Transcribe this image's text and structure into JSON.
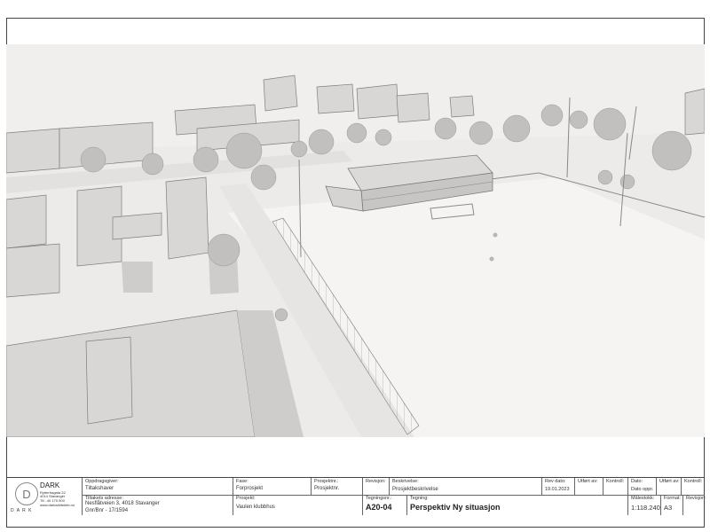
{
  "firm": {
    "name": "DARK",
    "address_line1": "Rytterfragata 22",
    "address_line2": "4014 Stavanger",
    "phone": "Tlf.: 40 170 500",
    "web": "www.darkarkitekter.no",
    "wordmark": "D A R K",
    "logo_letter": "D"
  },
  "title_block": {
    "oppdragsgiver_label": "Oppdragsgiver:",
    "oppdragsgiver": "Tiltakshaver",
    "tiltak_label": "Tiltakets adresse:",
    "tiltak_address": "Nesflåtveien 3, 4018 Stavanger",
    "gnr_bnr": "Gnr/Bnr - 17/1594",
    "fase_label": "Fase:",
    "fase": "Forprosjekt",
    "prosjektnr_label": "Prosjektnr.:",
    "prosjektnr": "Prosjektnr.",
    "prosjekt_label": "Prosjekt:",
    "prosjekt": "Vaulen klubbhus",
    "revisjon_label": "Revisjon:",
    "beskrivelse_label": "Beskrivelse:",
    "beskrivelse": "Prosjektbeskrivelse",
    "revdato_label": "Rev dato:",
    "revdato": "19.01.2023",
    "utfort1_label": "Utført av:",
    "kontroll1_label": "Kontroll:",
    "dato_label": "Dato:",
    "dato": "Dato oppr.",
    "utfort2_label": "Utført av:",
    "kontroll2_label": "Kontroll:",
    "tegningsnr_label": "Tegningsnr.:",
    "tegningsnr": "A20-04",
    "tegning_label": "Tegning:",
    "tegning": "Perspektiv Ny situasjon",
    "malestokk_label": "Målestokk:",
    "malestokk": "1:118.240",
    "format_label": "Format:",
    "format": "A3",
    "revisjon2_label": "Revisjon:"
  }
}
